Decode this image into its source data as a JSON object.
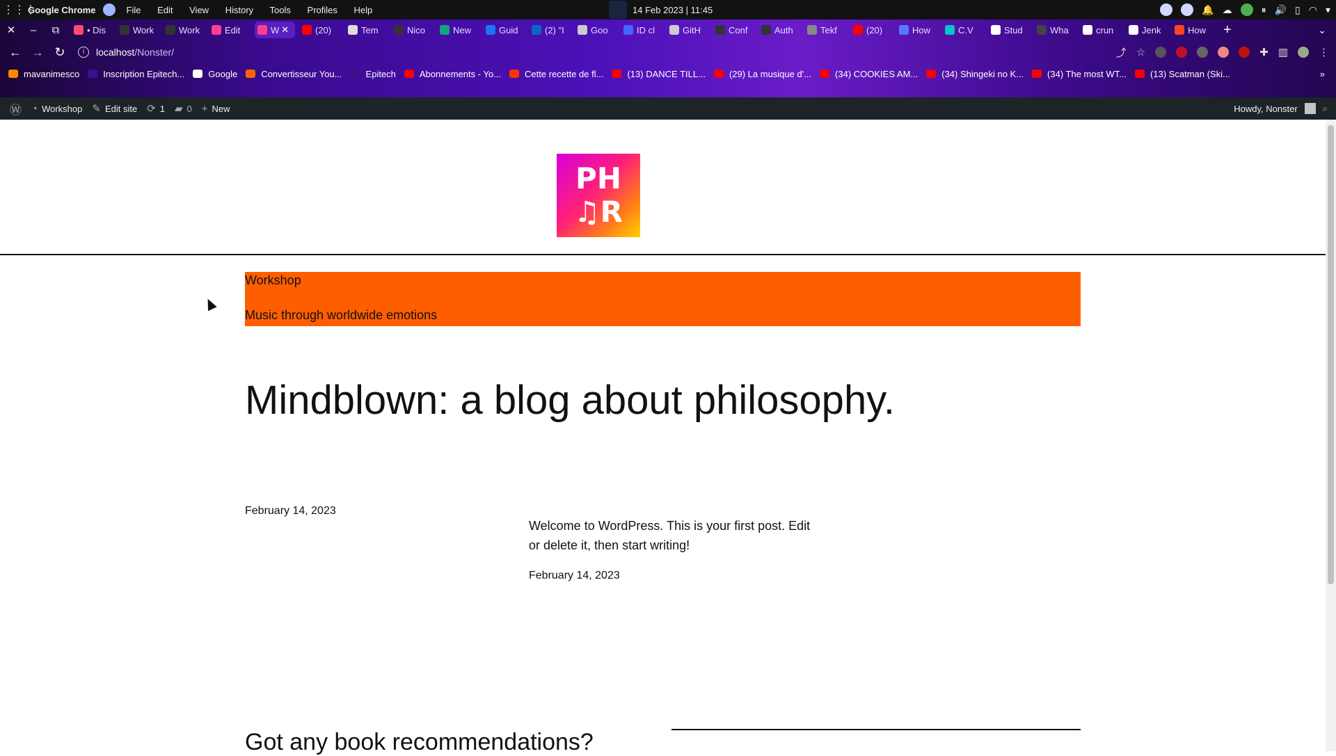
{
  "system_bar": {
    "app_name": "Google Chrome",
    "menu": [
      "File",
      "Edit",
      "View",
      "History",
      "Tools",
      "Profiles",
      "Help"
    ],
    "datetime": "14 Feb 2023 | 11:45"
  },
  "browser": {
    "tabs": [
      {
        "label": "• Dis",
        "icon": "discord-icon",
        "color": "#ff4b6e"
      },
      {
        "label": "Work",
        "icon": "github-icon",
        "color": "#333333"
      },
      {
        "label": "Work",
        "icon": "github-icon",
        "color": "#333333"
      },
      {
        "label": "Edit",
        "icon": "phr-logo-icon",
        "color": "#ff3c8e"
      },
      {
        "label": "W",
        "icon": "phr-logo-icon",
        "color": "#ff3c8e",
        "active": true
      },
      {
        "label": "(20)",
        "icon": "youtube-icon",
        "color": "#ff0000"
      },
      {
        "label": "Tem",
        "icon": "wordpress-icon",
        "color": "#dddddd"
      },
      {
        "label": "Nico",
        "icon": "github-icon",
        "color": "#333333"
      },
      {
        "label": "New",
        "icon": "chatgpt-icon",
        "color": "#10a37f"
      },
      {
        "label": "Guid",
        "icon": "facebook-icon",
        "color": "#1877f2"
      },
      {
        "label": "(2) \"I",
        "icon": "linkedin-icon",
        "color": "#0a66c2"
      },
      {
        "label": "Goo",
        "icon": "monitor-icon",
        "color": "#cccccc"
      },
      {
        "label": "ID cl",
        "icon": "api-icon",
        "color": "#4466ff"
      },
      {
        "label": "GitH",
        "icon": "monitor-icon",
        "color": "#cccccc"
      },
      {
        "label": "Conf",
        "icon": "github-icon",
        "color": "#333333"
      },
      {
        "label": "Auth",
        "icon": "github-icon",
        "color": "#333333"
      },
      {
        "label": "Tekf",
        "icon": "globe-icon",
        "color": "#888888"
      },
      {
        "label": "(20)",
        "icon": "youtube-icon",
        "color": "#ff0000"
      },
      {
        "label": "How",
        "icon": "infinity-icon",
        "color": "#5577ff"
      },
      {
        "label": "C.V",
        "icon": "canva-icon",
        "color": "#00c4cc"
      },
      {
        "label": "Stud",
        "icon": "k-icon",
        "color": "#ffffff"
      },
      {
        "label": "Wha",
        "icon": "blank-icon",
        "color": "#444444"
      },
      {
        "label": "crun",
        "icon": "google-icon",
        "color": "#ffffff"
      },
      {
        "label": "Jenk",
        "icon": "globe-icon",
        "color": "#ffffff"
      },
      {
        "label": "How",
        "icon": "stack-icon",
        "color": "#ff4422"
      }
    ],
    "url_host": "localhost",
    "url_path": "/Nonster/",
    "bookmarks": [
      {
        "label": "mavanimesco",
        "color": "#ff8800"
      },
      {
        "label": "Inscription Epitech...",
        "color": "#3a1090"
      },
      {
        "label": "Google",
        "color": "#ffffff"
      },
      {
        "label": "Convertisseur You...",
        "color": "#ff6600"
      },
      {
        "label": "Epitech",
        "color": "#3a1090"
      },
      {
        "label": "Abonnements - Yo...",
        "color": "#ff0000"
      },
      {
        "label": "Cette recette de fl...",
        "color": "#ff3300"
      },
      {
        "label": "(13) DANCE TILL...",
        "color": "#ff0000"
      },
      {
        "label": "(29) La musique d'...",
        "color": "#ff0000"
      },
      {
        "label": "(34) COOKIES AM...",
        "color": "#ff0000"
      },
      {
        "label": "(34) Shingeki no K...",
        "color": "#ff0000"
      },
      {
        "label": "(34) The most WT...",
        "color": "#ff0000"
      },
      {
        "label": "(13) Scatman (Ski...",
        "color": "#ff0000"
      }
    ]
  },
  "wp_admin_bar": {
    "site_name": "Workshop",
    "edit_site": "Edit site",
    "updates_count": "1",
    "comments_count": "0",
    "new_label": "New",
    "howdy": "Howdy, Nonster"
  },
  "site": {
    "logo_line1": "PH",
    "logo_line2": "♫R",
    "site_title": "Workshop",
    "tagline": "Music through worldwide emotions",
    "accent_color": "#ff5e00",
    "blog_title": "Mindblown: a blog about philosophy.",
    "post": {
      "date": "February 14, 2023",
      "excerpt": "Welcome to WordPress. This is your first post. Edit or delete it, then start writing!",
      "date_repeat": "February 14, 2023"
    },
    "footer_heading": "Got any book recommendations?"
  }
}
